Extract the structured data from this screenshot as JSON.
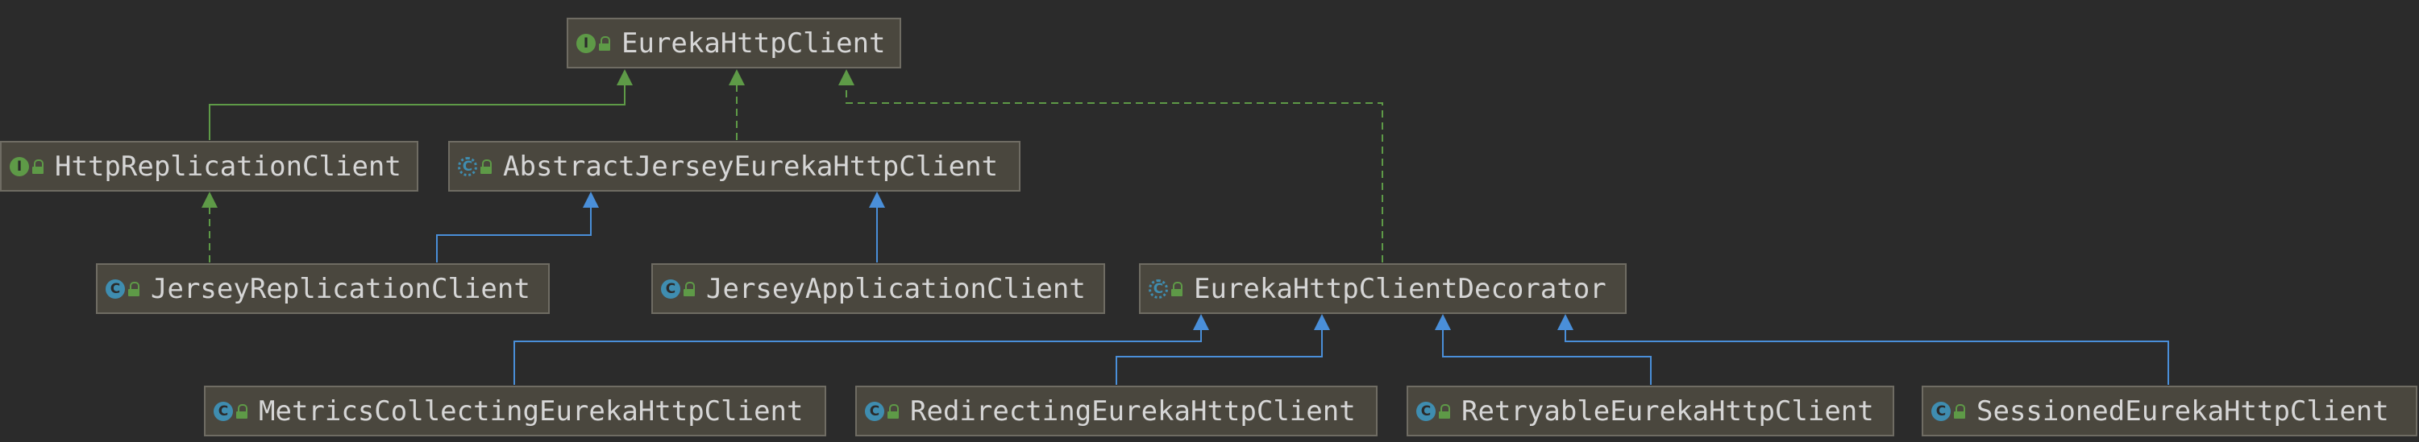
{
  "diagram": {
    "nodes": [
      {
        "id": "EurekaHttpClient",
        "label": "EurekaHttpClient",
        "kind": "interface",
        "icon": "interface-icon"
      },
      {
        "id": "HttpReplicationClient",
        "label": "HttpReplicationClient",
        "kind": "interface",
        "icon": "interface-icon"
      },
      {
        "id": "AbstractJerseyEurekaHttpClient",
        "label": "AbstractJerseyEurekaHttpClient",
        "kind": "abstract-class",
        "icon": "abstract-class-icon"
      },
      {
        "id": "JerseyReplicationClient",
        "label": "JerseyReplicationClient",
        "kind": "class",
        "icon": "class-icon"
      },
      {
        "id": "JerseyApplicationClient",
        "label": "JerseyApplicationClient",
        "kind": "class",
        "icon": "class-icon"
      },
      {
        "id": "EurekaHttpClientDecorator",
        "label": "EurekaHttpClientDecorator",
        "kind": "abstract-class",
        "icon": "abstract-class-icon"
      },
      {
        "id": "MetricsCollectingEurekaHttpClient",
        "label": "MetricsCollectingEurekaHttpClient",
        "kind": "class",
        "icon": "class-icon"
      },
      {
        "id": "RedirectingEurekaHttpClient",
        "label": "RedirectingEurekaHttpClient",
        "kind": "class",
        "icon": "class-icon"
      },
      {
        "id": "RetryableEurekaHttpClient",
        "label": "RetryableEurekaHttpClient",
        "kind": "class",
        "icon": "class-icon"
      },
      {
        "id": "SessionedEurekaHttpClient",
        "label": "SessionedEurekaHttpClient",
        "kind": "class",
        "icon": "class-icon"
      }
    ],
    "edges": [
      {
        "from": "HttpReplicationClient",
        "to": "EurekaHttpClient",
        "type": "extends"
      },
      {
        "from": "AbstractJerseyEurekaHttpClient",
        "to": "EurekaHttpClient",
        "type": "implements"
      },
      {
        "from": "EurekaHttpClientDecorator",
        "to": "EurekaHttpClient",
        "type": "implements"
      },
      {
        "from": "JerseyReplicationClient",
        "to": "HttpReplicationClient",
        "type": "implements"
      },
      {
        "from": "JerseyReplicationClient",
        "to": "AbstractJerseyEurekaHttpClient",
        "type": "extends"
      },
      {
        "from": "JerseyApplicationClient",
        "to": "AbstractJerseyEurekaHttpClient",
        "type": "extends"
      },
      {
        "from": "MetricsCollectingEurekaHttpClient",
        "to": "EurekaHttpClientDecorator",
        "type": "extends"
      },
      {
        "from": "RedirectingEurekaHttpClient",
        "to": "EurekaHttpClientDecorator",
        "type": "extends"
      },
      {
        "from": "RetryableEurekaHttpClient",
        "to": "EurekaHttpClientDecorator",
        "type": "extends"
      },
      {
        "from": "SessionedEurekaHttpClient",
        "to": "EurekaHttpClientDecorator",
        "type": "extends"
      }
    ],
    "colors": {
      "background": "#2b2b2b",
      "node_fill": "#4a473e",
      "node_border": "#6f6c63",
      "text": "#d6d6d6",
      "interface_edge": "#5e9a47",
      "class_edge": "#4a8fd9",
      "interface_icon": "#5e9a47",
      "class_icon": "#3f8db0"
    }
  }
}
